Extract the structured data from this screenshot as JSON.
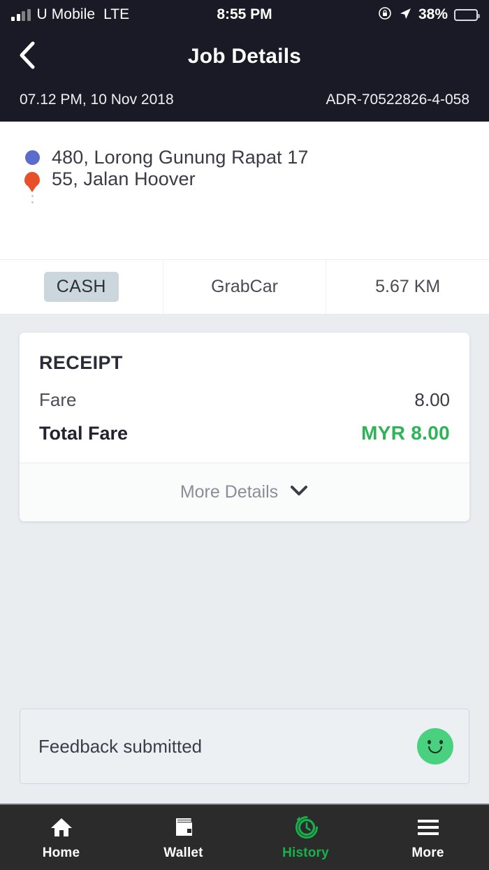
{
  "status_bar": {
    "carrier": "U Mobile",
    "network": "LTE",
    "time": "8:55 PM",
    "battery_percent": "38%",
    "signal_bars_filled": 2,
    "signal_bars_total": 4,
    "icons": [
      "rotation-lock-icon",
      "location-arrow-icon",
      "battery-icon"
    ]
  },
  "navbar": {
    "title": "Job Details",
    "back_icon": "chevron-left-icon"
  },
  "meta": {
    "datetime": "07.12 PM, 10 Nov 2018",
    "booking_code": "ADR-70522826-4-058"
  },
  "trip": {
    "pickup": {
      "address": "480, Lorong Gunung Rapat 17",
      "marker": "pickup-dot-icon",
      "marker_color": "#5b6ccd"
    },
    "dropoff": {
      "address": "55, Jalan Hoover",
      "marker": "destination-pin-icon",
      "marker_color": "#e8502a"
    }
  },
  "info_row": {
    "payment_method": "CASH",
    "payment_badge_color": "#ccd6dd",
    "service_type": "GrabCar",
    "distance": "5.67 KM"
  },
  "receipt": {
    "title": "RECEIPT",
    "lines": [
      {
        "label": "Fare",
        "value": "8.00"
      }
    ],
    "total_label": "Total Fare",
    "total_value": "MYR 8.00",
    "total_color": "#2eb457",
    "more_details_label": "More Details",
    "more_details_icon": "chevron-down-icon"
  },
  "feedback": {
    "text": "Feedback submitted",
    "icon": "smiley-face-icon",
    "icon_color": "#4ad17f"
  },
  "tabbar": {
    "items": [
      {
        "label": "Home",
        "icon": "home-icon",
        "active": false
      },
      {
        "label": "Wallet",
        "icon": "wallet-icon",
        "active": false
      },
      {
        "label": "History",
        "icon": "history-clock-icon",
        "active": true
      },
      {
        "label": "More",
        "icon": "hamburger-menu-icon",
        "active": false
      }
    ],
    "active_color": "#17b14b"
  }
}
